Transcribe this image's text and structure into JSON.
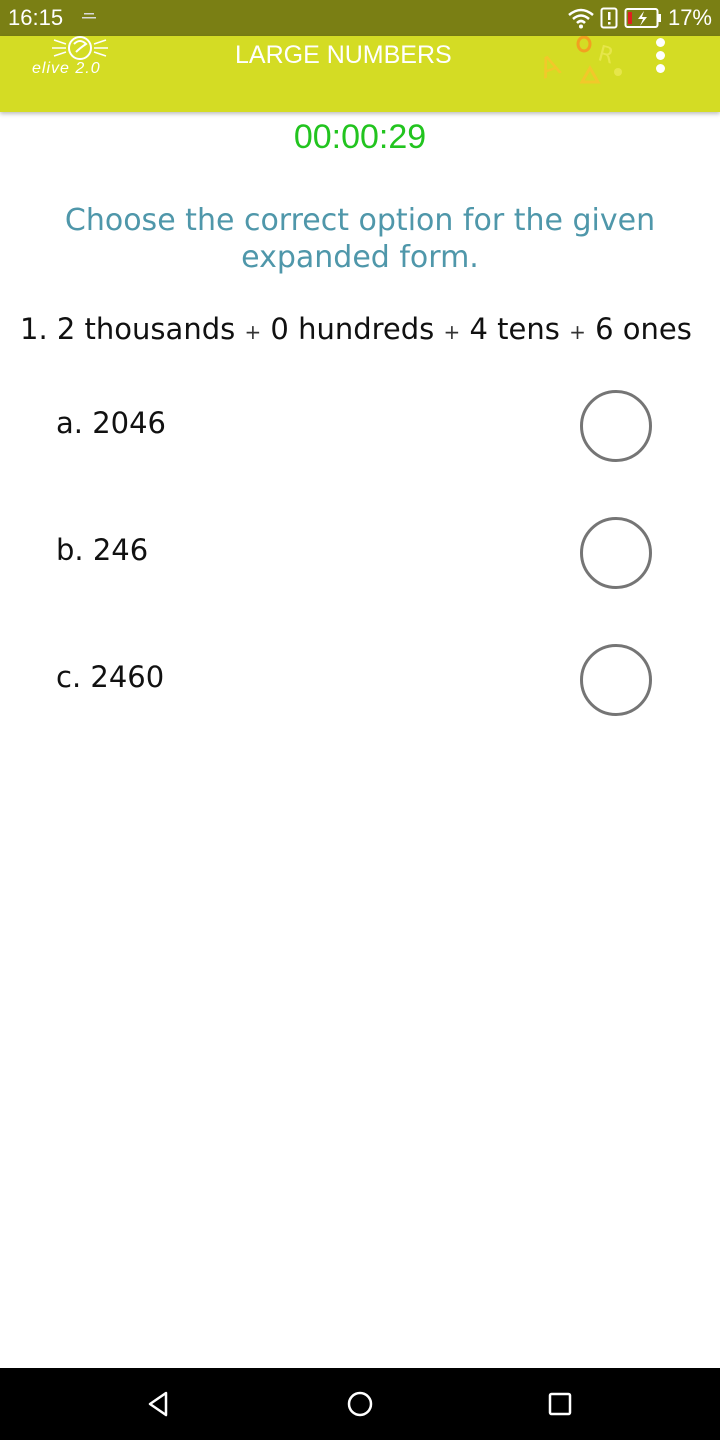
{
  "status_bar": {
    "time": "16:15",
    "battery_percent": "17%",
    "icons": [
      "notification-icon",
      "wifi-icon",
      "alert-icon",
      "battery-charging-icon"
    ]
  },
  "app_bar": {
    "title": "LARGE NUMBERS",
    "logo_text": "elive 2.0",
    "menu_icon": "overflow-menu-icon"
  },
  "quiz": {
    "timer": "00:00:29",
    "instruction": "Choose the correct option for the given expanded form.",
    "question": {
      "number": "1.",
      "parts": [
        "2 thousands",
        "0 hundreds",
        "4 tens",
        "6 ones"
      ],
      "operator": "+"
    },
    "options": [
      {
        "label": "a. 2046",
        "selected": false
      },
      {
        "label": "b. 246",
        "selected": false
      },
      {
        "label": "c. 2460",
        "selected": false
      }
    ]
  },
  "colors": {
    "status_bar": "#7a7f14",
    "app_bar": "#d4dc24",
    "timer": "#22c41f",
    "instruction": "#4f97aa"
  },
  "nav_bar": {
    "icons": [
      "back-icon",
      "home-icon",
      "recents-icon"
    ]
  }
}
